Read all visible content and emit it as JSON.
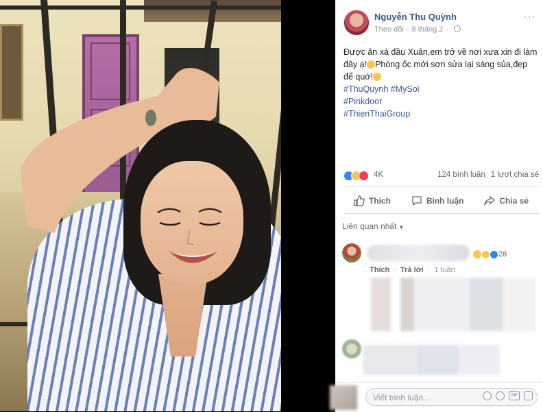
{
  "post": {
    "author": "Nguyễn Thu Quỳnh",
    "follow_label": "Theo dõi",
    "separator": "·",
    "date": "8 tháng 2",
    "more_label": "···",
    "text_line1": "Được ân xá đầu Xuân,em trở về nơi xưa xin đi làm đây ạ!",
    "text_line2": "Phòng ốc mới sơn sửa lại sáng sủa,đẹp để quớ!",
    "hashtags": [
      "#ThuQuynh #MySoi",
      "#Pinkdoor",
      "#ThienThaiGroup"
    ],
    "reaction_count": "4K",
    "comment_count": "124 bình luận",
    "share_count": "1 lượt chia sẻ"
  },
  "actions": {
    "like": "Thích",
    "comment": "Bình luận",
    "share": "Chia sẻ"
  },
  "sort": {
    "label": "Liên quan nhất"
  },
  "comments": [
    {
      "reaction_count": "28",
      "like_label": "Thích",
      "reply_label": "Trả lời",
      "time": "1 tuần"
    }
  ],
  "composer": {
    "placeholder": "Viết bình luận...",
    "icons": [
      "emoji-icon",
      "camera-icon",
      "gif-icon",
      "sticker-icon"
    ]
  },
  "colors": {
    "link": "#365899",
    "meta": "#90949c",
    "like_blue": "#2d88ff",
    "love_red": "#f33e58",
    "haha_yellow": "#f7c94a"
  }
}
